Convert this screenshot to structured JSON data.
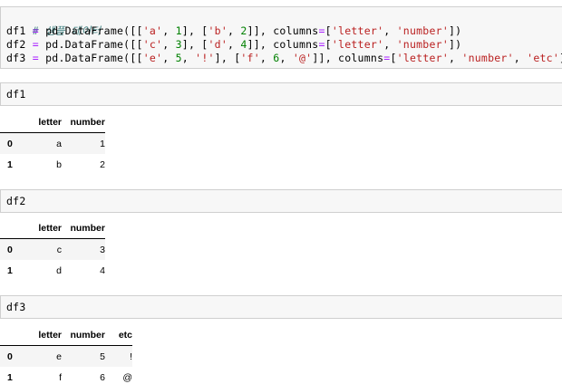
{
  "code_cell": {
    "comment": "# 샘플 데이터",
    "lines": [
      {
        "var": "df1",
        "call": "pd.DataFrame([[",
        "row1": [
          "'a'",
          "1"
        ],
        "row2": [
          "'b'",
          "2"
        ],
        "columns": [
          "'letter'",
          "'number'"
        ]
      },
      {
        "var": "df2",
        "call": "pd.DataFrame([[",
        "row1": [
          "'c'",
          "3"
        ],
        "row2": [
          "'d'",
          "4"
        ],
        "columns": [
          "'letter'",
          "'number'"
        ]
      },
      {
        "var": "df3",
        "call": "pd.DataFrame([[",
        "row1": [
          "'e'",
          "5",
          "'!'"
        ],
        "row2": [
          "'f'",
          "6",
          "'@'"
        ],
        "columns": [
          "'letter'",
          "'number'",
          "'etc'"
        ]
      }
    ]
  },
  "cells": [
    {
      "input": "df1",
      "table": {
        "columns": [
          "letter",
          "number"
        ],
        "rows": [
          {
            "index": "0",
            "values": [
              "a",
              "1"
            ]
          },
          {
            "index": "1",
            "values": [
              "b",
              "2"
            ]
          }
        ]
      }
    },
    {
      "input": "df2",
      "table": {
        "columns": [
          "letter",
          "number"
        ],
        "rows": [
          {
            "index": "0",
            "values": [
              "c",
              "3"
            ]
          },
          {
            "index": "1",
            "values": [
              "d",
              "4"
            ]
          }
        ]
      }
    },
    {
      "input": "df3",
      "table": {
        "columns": [
          "letter",
          "number",
          "etc"
        ],
        "rows": [
          {
            "index": "0",
            "values": [
              "e",
              "5",
              "!"
            ]
          },
          {
            "index": "1",
            "values": [
              "f",
              "6",
              "@"
            ]
          }
        ]
      }
    }
  ]
}
